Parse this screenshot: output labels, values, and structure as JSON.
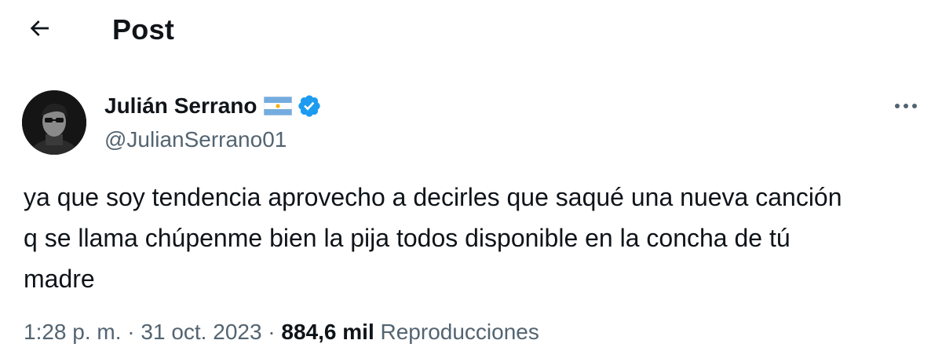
{
  "header": {
    "title": "Post"
  },
  "author": {
    "name": "Julián Serrano",
    "handle": "@JulianSerrano01",
    "flag": "argentina-flag",
    "verified": true
  },
  "tweet": {
    "text": "ya que soy tendencia aprovecho a decirles que saqué una nueva canción\nq se llama chúpenme bien la pija todos disponible en la concha de tú\nmadre"
  },
  "meta": {
    "time": "1:28 p. m.",
    "separator": " · ",
    "date": "31 oct. 2023",
    "views_count": "884,6 mil",
    "views_label": "Reproducciones"
  },
  "colors": {
    "verified_blue": "#1d9bf0",
    "text_primary": "#0f1419",
    "text_secondary": "#536471",
    "flag_blue": "#74acdf",
    "flag_sun": "#f6b40e"
  }
}
